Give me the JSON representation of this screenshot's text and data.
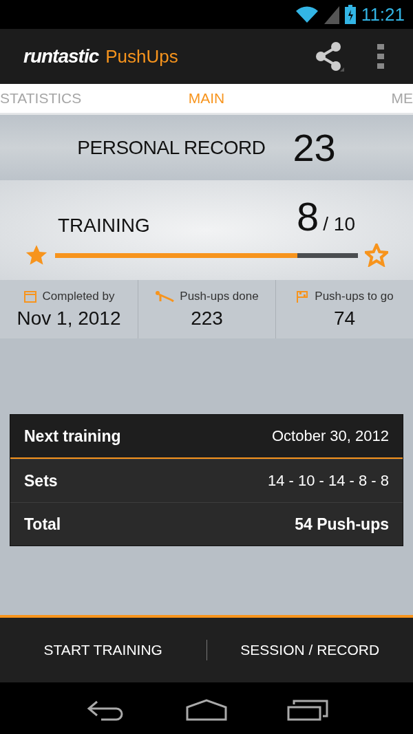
{
  "status_bar": {
    "time": "11:21"
  },
  "action_bar": {
    "brand": "runtastic",
    "app_name": "PushUps"
  },
  "tabs": [
    {
      "label": "STATISTICS",
      "selected": false
    },
    {
      "label": "MAIN",
      "selected": true
    },
    {
      "label": "ME",
      "selected": false
    }
  ],
  "personal_record": {
    "label": "PERSONAL RECORD",
    "value": "23"
  },
  "training": {
    "label": "TRAINING",
    "current": "8",
    "total": "/ 10",
    "level": 0.8,
    "start_reached": true,
    "goal_reached": false
  },
  "stats": [
    {
      "kind": "calendar",
      "label": "Completed by",
      "value": "Nov 1, 2012"
    },
    {
      "kind": "pushup",
      "label": "Push-ups done",
      "value": "223"
    },
    {
      "kind": "flag",
      "label": "Push-ups to go",
      "value": "74"
    }
  ],
  "next_training": {
    "rows": [
      {
        "label": "Next training",
        "value": "October 30, 2012"
      },
      {
        "label": "Sets",
        "value": "14 - 10 - 14 - 8 - 8"
      },
      {
        "label": "Total",
        "value": "54  Push-ups"
      }
    ]
  },
  "buttons": [
    "START TRAINING",
    "SESSION / RECORD"
  ]
}
